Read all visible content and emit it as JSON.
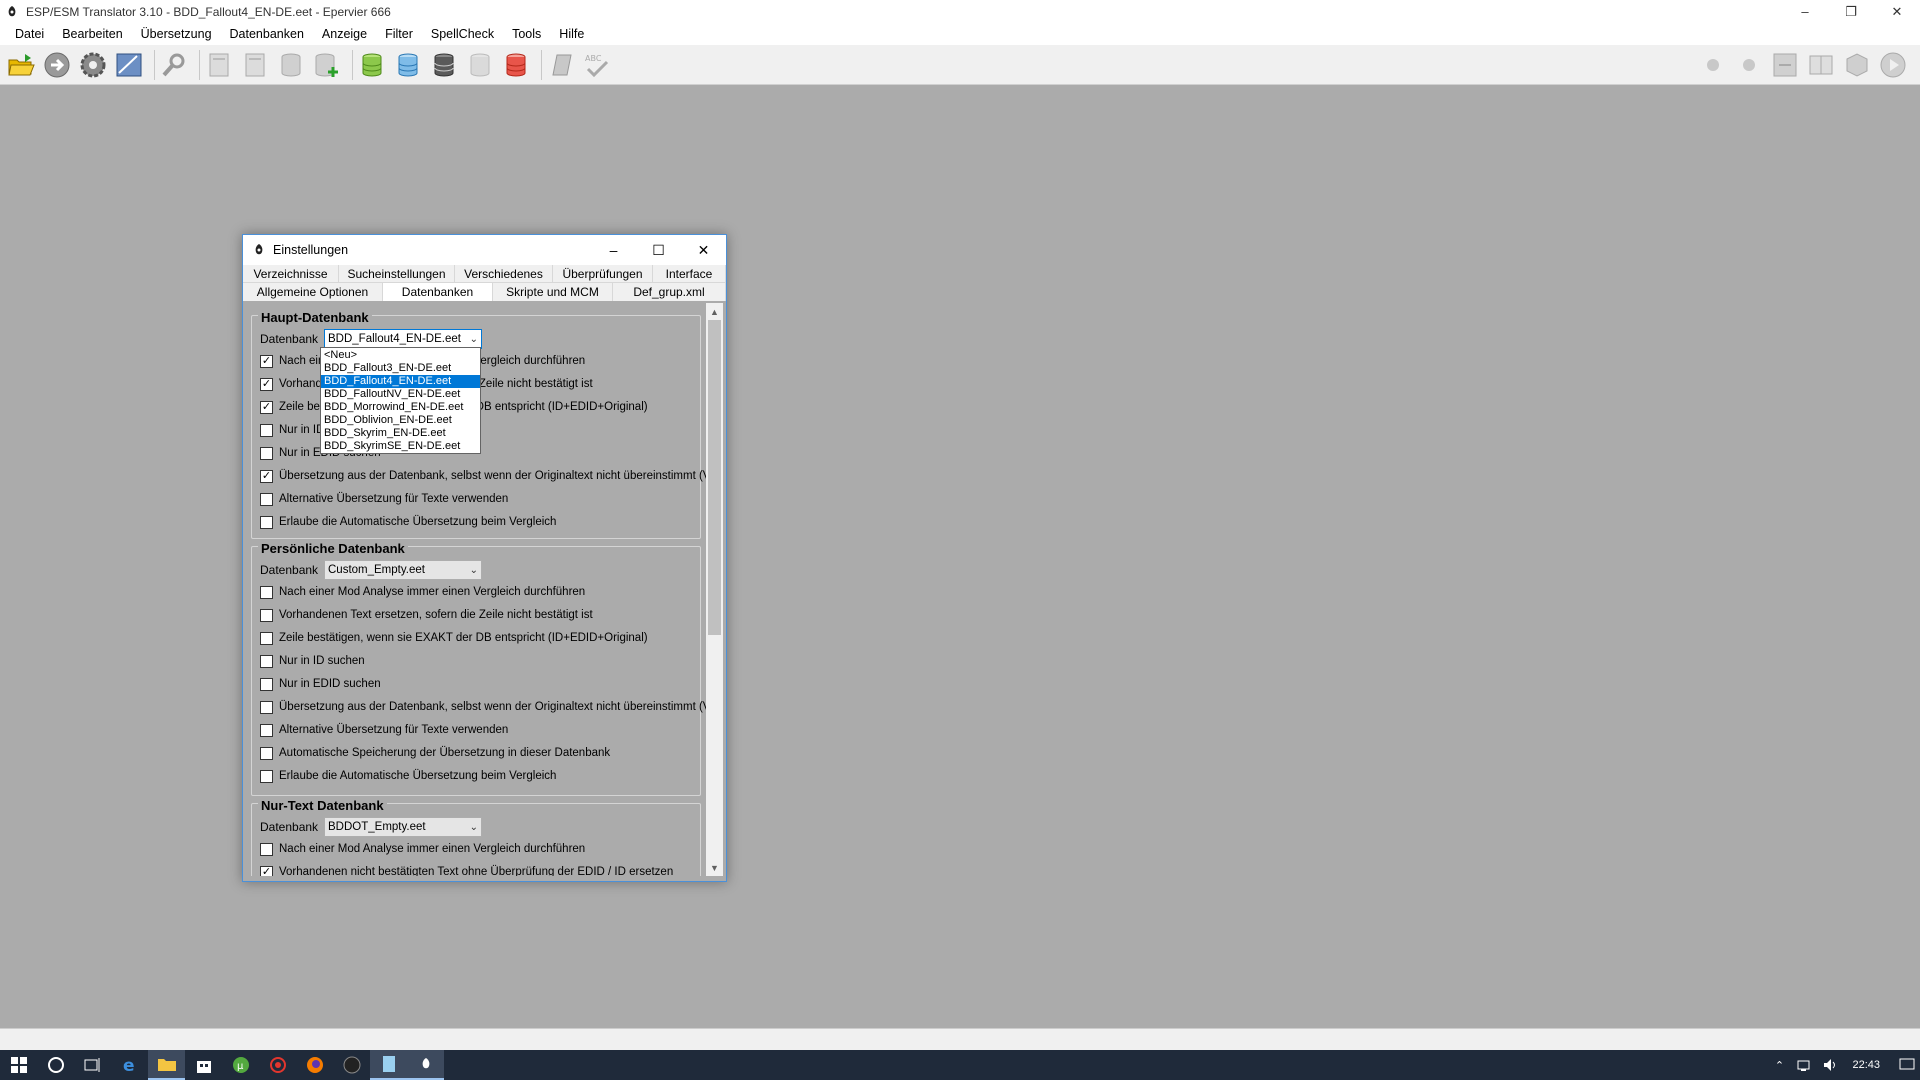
{
  "window": {
    "title": "ESP/ESM Translator 3.10 - BDD_Fallout4_EN-DE.eet - Epervier 666",
    "controls": [
      "minimize-icon",
      "restore-icon",
      "close-icon"
    ]
  },
  "menu": [
    "Datei",
    "Bearbeiten",
    "Übersetzung",
    "Datenbanken",
    "Anzeige",
    "Filter",
    "SpellCheck",
    "Tools",
    "Hilfe"
  ],
  "toolbar": {
    "left_icons": [
      "open-folder-icon",
      "arrow-right-icon",
      "gear-icon",
      "edit-chart-icon",
      "search-key-icon",
      "page-icon",
      "page-icon",
      "db-gray-icon",
      "db-add-icon",
      "db-green-icon",
      "db-blue-icon",
      "db-dark-icon",
      "db-light-icon",
      "db-red-icon",
      "eraser-icon",
      "spellcheck-icon"
    ],
    "right_icons": [
      "circle-icon",
      "circle-icon",
      "compare-icon",
      "book-icon",
      "package-icon",
      "play-icon"
    ]
  },
  "dialog": {
    "title": "Einstellungen",
    "tabs_row1": [
      "Verzeichnisse",
      "Sucheinstellungen",
      "Verschiedenes",
      "Überprüfungen",
      "Interface"
    ],
    "tabs_row2": [
      "Allgemeine Optionen",
      "Datenbanken",
      "Skripte und MCM",
      "Def_grup.xml"
    ],
    "selected_tab": "Datenbanken",
    "haupt": {
      "title": "Haupt-Datenbank",
      "db_label": "Datenbank",
      "db_value": "BDD_Fallout4_EN-DE.eet",
      "options": [
        {
          "label": "Nach einer Mod Analyse immer einen Vergleich durchführen",
          "checked": true
        },
        {
          "label": "Vorhandenen Text ersetzen, sofern die Zeile nicht bestätigt ist",
          "checked": true
        },
        {
          "label": "Zeile bestätigen, wenn sie EXAKT der DB entspricht (ID+EDID+Original)",
          "checked": true
        },
        {
          "label": "Nur in ID suchen",
          "checked": false
        },
        {
          "label": "Nur in EDID suchen",
          "checked": false
        },
        {
          "label": "Übersetzung aus der Datenbank, selbst wenn der Originaltext nicht übereinstimmt (Vorsicht",
          "checked": true
        },
        {
          "label": "Alternative Übersetzung für Texte verwenden",
          "checked": false
        },
        {
          "label": "Erlaube die Automatische Übersetzung beim Vergleich",
          "checked": false
        }
      ]
    },
    "persoenlich": {
      "title": "Persönliche Datenbank",
      "db_label": "Datenbank",
      "db_value": "Custom_Empty.eet",
      "options": [
        {
          "label": "Nach einer Mod Analyse immer einen Vergleich durchführen",
          "checked": false
        },
        {
          "label": "Vorhandenen Text ersetzen, sofern die Zeile nicht bestätigt ist",
          "checked": false
        },
        {
          "label": "Zeile bestätigen, wenn sie EXAKT der DB entspricht (ID+EDID+Original)",
          "checked": false
        },
        {
          "label": "Nur in ID suchen",
          "checked": false
        },
        {
          "label": "Nur in EDID suchen",
          "checked": false
        },
        {
          "label": "Übersetzung aus der Datenbank, selbst wenn der Originaltext nicht übereinstimmt (Vorsicht",
          "checked": false
        },
        {
          "label": "Alternative Übersetzung für Texte verwenden",
          "checked": false
        },
        {
          "label": "Automatische Speicherung der Übersetzung in dieser Datenbank",
          "checked": false
        },
        {
          "label": "Erlaube die Automatische Übersetzung beim Vergleich",
          "checked": false
        }
      ]
    },
    "nurtext": {
      "title": "Nur-Text Datenbank",
      "db_label": "Datenbank",
      "db_value": "BDDOT_Empty.eet",
      "options": [
        {
          "label": "Nach einer Mod Analyse immer einen Vergleich durchführen",
          "checked": false
        },
        {
          "label": "Vorhandenen nicht bestätigten Text ohne Überprüfung der EDID / ID ersetzen",
          "checked": true
        }
      ]
    },
    "dropdown": {
      "options": [
        "<Neu>",
        "BDD_Fallout3_EN-DE.eet",
        "BDD_Fallout4_EN-DE.eet",
        "BDD_FalloutNV_EN-DE.eet",
        "BDD_Morrowind_EN-DE.eet",
        "BDD_Oblivion_EN-DE.eet",
        "BDD_Skyrim_EN-DE.eet",
        "BDD_SkyrimSE_EN-DE.eet"
      ],
      "selected_index": 2
    }
  },
  "taskbar": {
    "icons": [
      "windows-start-icon",
      "cortana-search-icon",
      "task-view-icon",
      "edge-icon",
      "file-explorer-icon",
      "store-icon",
      "utorrent-icon",
      "media-icon",
      "firefox-icon",
      "steam-icon",
      "notepad-icon",
      "translator-icon"
    ],
    "clock": "22:43",
    "tray_icons": [
      "chevron-up-icon",
      "network-icon",
      "volume-icon"
    ]
  },
  "colors": {
    "accent": "#0078d7",
    "workspace": "#ababab",
    "taskbar": "#1f2a3a"
  }
}
